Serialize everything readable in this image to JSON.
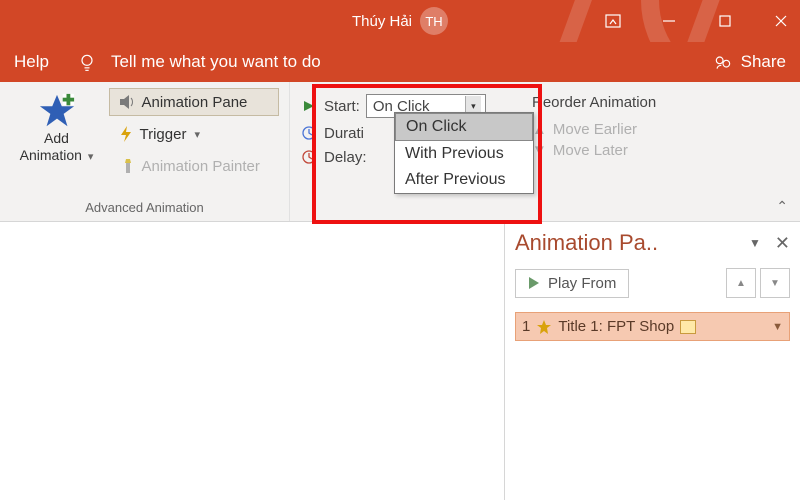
{
  "titlebar": {
    "username": "Thúy Hải",
    "initials": "TH"
  },
  "helprow": {
    "help": "Help",
    "tellme": "Tell me what you want to do",
    "share": "Share"
  },
  "ribbon": {
    "add_animation": {
      "line1": "Add",
      "line2": "Animation"
    },
    "advanced_group_label": "Advanced Animation",
    "animation_pane": "Animation Pane",
    "trigger": "Trigger",
    "animation_painter": "Animation Painter",
    "timing": {
      "start_label": "Start:",
      "start_value": "On Click",
      "duration_label": "Durati",
      "delay_label": "Delay:"
    },
    "start_options": [
      "On Click",
      "With Previous",
      "After Previous"
    ],
    "reorder": {
      "header": "Reorder Animation",
      "earlier": "Move Earlier",
      "later": "Move Later"
    }
  },
  "pane": {
    "title": "Animation Pa..",
    "play": "Play From",
    "item_index": "1",
    "item_label": "Title 1: FPT Shop"
  }
}
